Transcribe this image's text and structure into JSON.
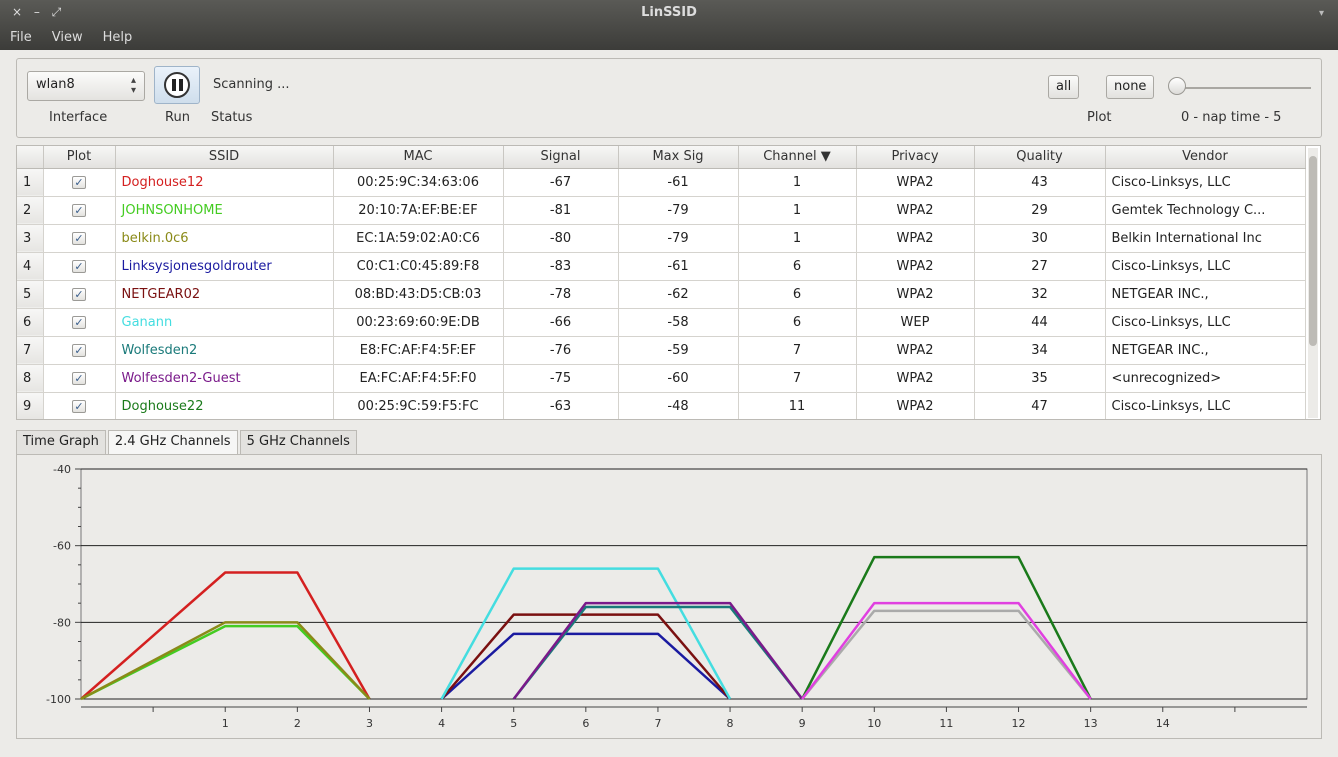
{
  "window": {
    "title": "LinSSID",
    "controls": "×  –  ⤢",
    "caret": "▾"
  },
  "menu": [
    "File",
    "View",
    "Help"
  ],
  "toolbar": {
    "interface_value": "wlan8",
    "interface_label": "Interface",
    "run_label": "Run",
    "status_label": "Status",
    "status_value": "Scanning ...",
    "all_label": "all",
    "none_label": "none",
    "plot_label": "Plot",
    "nap_label": "0 - nap time - 5"
  },
  "table": {
    "headers": [
      "Plot",
      "SSID",
      "MAC",
      "Signal",
      "Max Sig",
      "Channel ▼",
      "Privacy",
      "Quality",
      "Vendor"
    ],
    "rows": [
      {
        "num": "1",
        "ssid": "Doghouse12",
        "color": "#d42020",
        "mac": "00:25:9C:34:63:06",
        "signal": "-67",
        "max": "-61",
        "channel": "1",
        "privacy": "WPA2",
        "quality": "43",
        "vendor": "Cisco-Linksys, LLC"
      },
      {
        "num": "2",
        "ssid": "JOHNSONHOME",
        "color": "#44cc22",
        "mac": "20:10:7A:EF:BE:EF",
        "signal": "-81",
        "max": "-79",
        "channel": "1",
        "privacy": "WPA2",
        "quality": "29",
        "vendor": "Gemtek Technology C..."
      },
      {
        "num": "3",
        "ssid": "belkin.0c6",
        "color": "#8a8a18",
        "mac": "EC:1A:59:02:A0:C6",
        "signal": "-80",
        "max": "-79",
        "channel": "1",
        "privacy": "WPA2",
        "quality": "30",
        "vendor": "Belkin International Inc"
      },
      {
        "num": "4",
        "ssid": "Linksysjonesgoldrouter",
        "color": "#1a1aa0",
        "mac": "C0:C1:C0:45:89:F8",
        "signal": "-83",
        "max": "-61",
        "channel": "6",
        "privacy": "WPA2",
        "quality": "27",
        "vendor": "Cisco-Linksys, LLC"
      },
      {
        "num": "5",
        "ssid": "NETGEAR02",
        "color": "#7a1010",
        "mac": "08:BD:43:D5:CB:03",
        "signal": "-78",
        "max": "-62",
        "channel": "6",
        "privacy": "WPA2",
        "quality": "32",
        "vendor": "NETGEAR INC.,"
      },
      {
        "num": "6",
        "ssid": "Ganann",
        "color": "#44dde0",
        "mac": "00:23:69:60:9E:DB",
        "signal": "-66",
        "max": "-58",
        "channel": "6",
        "privacy": "WEP",
        "quality": "44",
        "vendor": "Cisco-Linksys, LLC"
      },
      {
        "num": "7",
        "ssid": "Wolfesden2",
        "color": "#1a7a7a",
        "mac": "E8:FC:AF:F4:5F:EF",
        "signal": "-76",
        "max": "-59",
        "channel": "7",
        "privacy": "WPA2",
        "quality": "34",
        "vendor": "NETGEAR INC.,"
      },
      {
        "num": "8",
        "ssid": "Wolfesden2-Guest",
        "color": "#7a1a8a",
        "mac": "EA:FC:AF:F4:5F:F0",
        "signal": "-75",
        "max": "-60",
        "channel": "7",
        "privacy": "WPA2",
        "quality": "35",
        "vendor": "<unrecognized>"
      },
      {
        "num": "9",
        "ssid": "Doghouse22",
        "color": "#1a7a1a",
        "mac": "00:25:9C:59:F5:FC",
        "signal": "-63",
        "max": "-48",
        "channel": "11",
        "privacy": "WPA2",
        "quality": "47",
        "vendor": "Cisco-Linksys, LLC"
      }
    ]
  },
  "tabs": [
    "Time Graph",
    "2.4 GHz Channels",
    "5 GHz Channels"
  ],
  "active_tab": "2.4 GHz Channels",
  "chart_data": {
    "type": "line",
    "title": "",
    "xlabel": "",
    "ylabel": "",
    "x_ticks": [
      1,
      2,
      3,
      4,
      5,
      6,
      7,
      8,
      9,
      10,
      11,
      12,
      13,
      14
    ],
    "y_ticks": [
      -40,
      -60,
      -80,
      -100
    ],
    "ylim": [
      -100,
      -40
    ],
    "xlim": [
      -1,
      16
    ],
    "grid": "horizontal",
    "series": [
      {
        "name": "Doghouse12",
        "color": "#d42020",
        "x": [
          -1,
          1,
          2,
          3
        ],
        "y": [
          -100,
          -67,
          -67,
          -100
        ]
      },
      {
        "name": "JOHNSONHOME",
        "color": "#44cc22",
        "x": [
          -1,
          1,
          2,
          3
        ],
        "y": [
          -100,
          -81,
          -81,
          -100
        ]
      },
      {
        "name": "belkin.0c6",
        "color": "#8a8a18",
        "x": [
          -1,
          1,
          2,
          3
        ],
        "y": [
          -100,
          -80,
          -80,
          -100
        ]
      },
      {
        "name": "Linksysjonesgoldrouter",
        "color": "#1a1aa0",
        "x": [
          4,
          5,
          7,
          8
        ],
        "y": [
          -100,
          -83,
          -83,
          -100
        ]
      },
      {
        "name": "NETGEAR02",
        "color": "#7a1010",
        "x": [
          4,
          5,
          7,
          8
        ],
        "y": [
          -100,
          -78,
          -78,
          -100
        ]
      },
      {
        "name": "Ganann",
        "color": "#44dde0",
        "x": [
          4,
          5,
          7,
          8
        ],
        "y": [
          -100,
          -66,
          -66,
          -100
        ]
      },
      {
        "name": "Wolfesden2",
        "color": "#1a7a7a",
        "x": [
          5,
          6,
          8,
          9
        ],
        "y": [
          -100,
          -76,
          -76,
          -100
        ]
      },
      {
        "name": "Wolfesden2-Guest",
        "color": "#7a1a8a",
        "x": [
          5,
          6,
          8,
          9
        ],
        "y": [
          -100,
          -75,
          -75,
          -100
        ]
      },
      {
        "name": "Doghouse22",
        "color": "#1a7a1a",
        "x": [
          9,
          10,
          12,
          13
        ],
        "y": [
          -100,
          -63,
          -63,
          -100
        ]
      },
      {
        "name": "",
        "color": "#aaaaaa",
        "x": [
          9,
          10,
          12,
          13
        ],
        "y": [
          -100,
          -77,
          -77,
          -100
        ]
      },
      {
        "name": "",
        "color": "#e040e0",
        "x": [
          9,
          10,
          12,
          13
        ],
        "y": [
          -100,
          -75,
          -75,
          -100
        ]
      }
    ]
  }
}
